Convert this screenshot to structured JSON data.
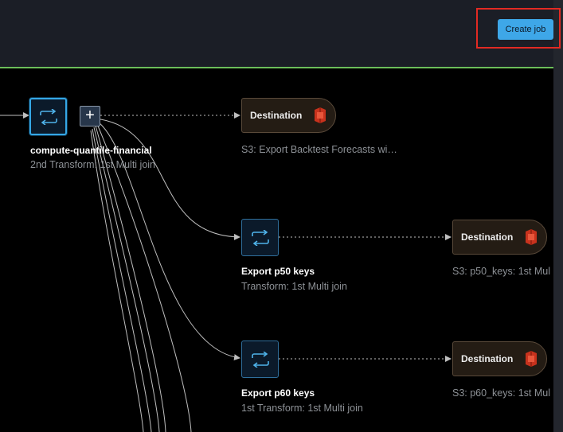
{
  "header": {
    "create_job_label": "Create job"
  },
  "nodes": {
    "compute": {
      "title": "compute-quantile-financial",
      "subtitle": "2nd Transform: 1st Multi join",
      "icon": "transform-icon"
    },
    "export_p50": {
      "title": "Export p50 keys",
      "subtitle": "Transform: 1st Multi join",
      "icon": "transform-icon"
    },
    "export_p60": {
      "title": "Export p60 keys",
      "subtitle": "1st Transform: 1st Multi join",
      "icon": "transform-icon"
    }
  },
  "destinations": [
    {
      "label": "Destination",
      "subtitle": "S3: Export Backtest Forecasts wi…",
      "icon": "s3-bucket-icon"
    },
    {
      "label": "Destination",
      "subtitle": "S3: p50_keys: 1st Mul",
      "icon": "s3-bucket-icon"
    },
    {
      "label": "Destination",
      "subtitle": "S3: p60_keys: 1st Mul",
      "icon": "s3-bucket-icon"
    }
  ],
  "add_node": {
    "symbol": "+",
    "icon": "plus-icon"
  },
  "colors": {
    "accent": "#3ea7e8",
    "selected_border": "#35a7e6",
    "header_divider": "#6cbf5a",
    "highlight": "#e22a23",
    "s3": "#d13212"
  }
}
